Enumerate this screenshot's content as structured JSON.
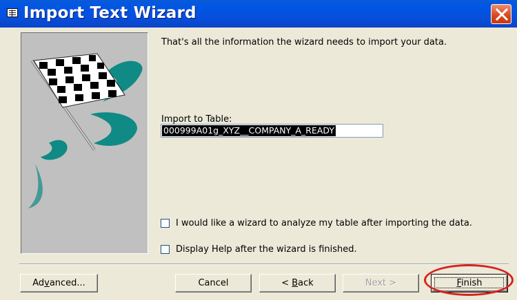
{
  "window": {
    "title": "Import Text Wizard",
    "icons": {
      "system": "table-icon",
      "close": "close-icon",
      "banner": "checkered-flag-icon"
    },
    "colors": {
      "titlebar": "#0055e5",
      "close": "#d9451c",
      "highlight": "#d8231c"
    }
  },
  "body": {
    "info_text": "That's all the information the wizard needs to import your data.",
    "import_label": "Import to Table:",
    "table_name": "000999A01g_XYZ__COMPANY_A_READY",
    "analyze_checkbox": {
      "label": "I would like a wizard to analyze my table after importing the data.",
      "checked": false
    },
    "help_checkbox": {
      "label": "Display Help after the wizard is finished.",
      "checked": false
    }
  },
  "buttons": {
    "advanced": {
      "pre": "Ad",
      "key": "v",
      "post": "anced..."
    },
    "cancel": {
      "label": "Cancel"
    },
    "back": {
      "pre": "< ",
      "key": "B",
      "post": "ack"
    },
    "next": {
      "label": "Next >",
      "enabled": false
    },
    "finish": {
      "pre": "",
      "key": "F",
      "post": "inish",
      "default": true
    }
  }
}
